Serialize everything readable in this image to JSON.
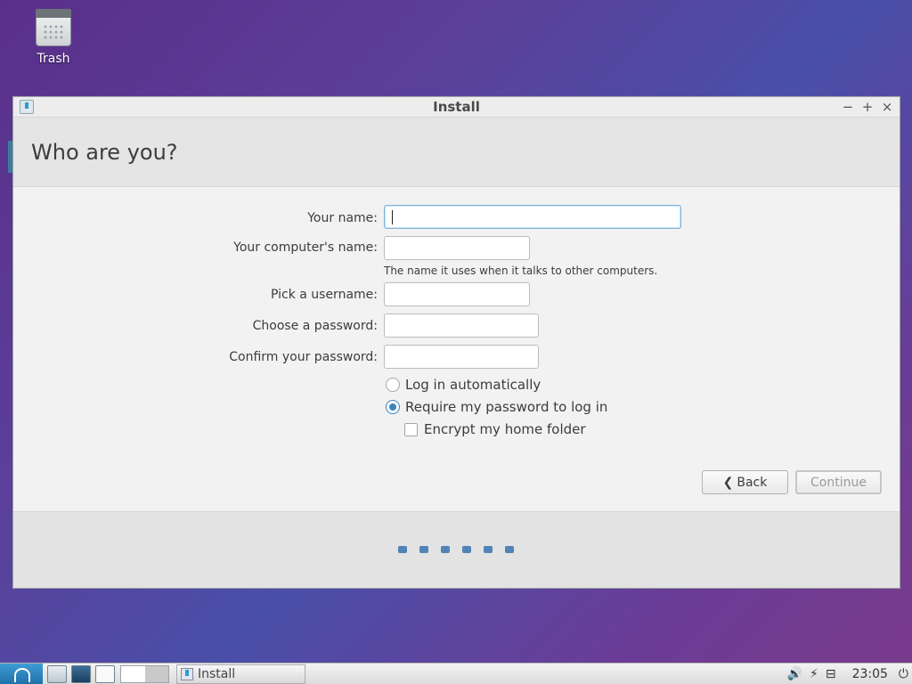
{
  "desktop": {
    "trash_label": "Trash"
  },
  "window": {
    "title": "Install",
    "heading": "Who are you?",
    "controls": {
      "minimize": "−",
      "maximize": "+",
      "close": "×"
    }
  },
  "form": {
    "name_label": "Your name:",
    "name_value": "",
    "computer_label": "Your computer's name:",
    "computer_value": "",
    "computer_hint": "The name it uses when it talks to other computers.",
    "username_label": "Pick a username:",
    "username_value": "",
    "password_label": "Choose a password:",
    "password_value": "",
    "confirm_label": "Confirm your password:",
    "confirm_value": "",
    "opt_auto_login": "Log in automatically",
    "opt_require_password": "Require my password to log in",
    "opt_encrypt_home": "Encrypt my home folder",
    "selected_login_option": "Require my password to log in"
  },
  "buttons": {
    "back": "Back",
    "continue": "Continue"
  },
  "progress": {
    "total_steps": 6
  },
  "taskbar": {
    "task_label": "Install",
    "clock": "23:05",
    "volume_glyph": "🔊",
    "network_glyph": "⊟",
    "power_glyph": "⏻",
    "battery_glyph": "⚡"
  }
}
